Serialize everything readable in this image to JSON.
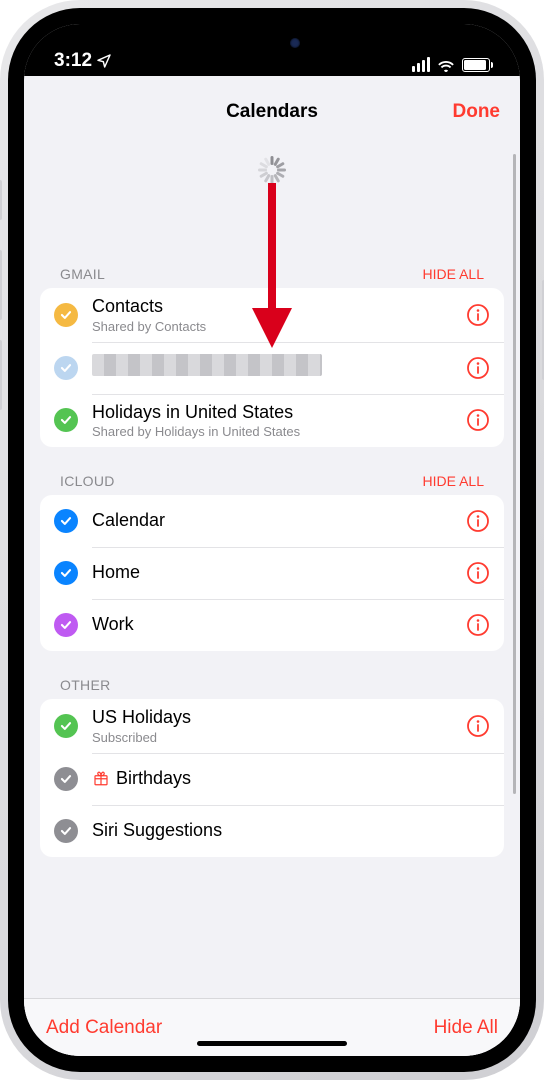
{
  "status": {
    "time": "3:12"
  },
  "header": {
    "title": "Calendars",
    "done": "Done"
  },
  "groups": [
    {
      "label": "GMAIL",
      "hide": "HIDE ALL",
      "items": [
        {
          "title": "Contacts",
          "sub": "Shared by Contacts",
          "color": "#f5b942",
          "info": true,
          "redacted": false,
          "icon": ""
        },
        {
          "title": "",
          "sub": "",
          "color": "#bcd6f0",
          "info": true,
          "redacted": true,
          "icon": ""
        },
        {
          "title": "Holidays in United States",
          "sub": "Shared by Holidays in United States",
          "color": "#54c452",
          "info": true,
          "redacted": false,
          "icon": ""
        }
      ]
    },
    {
      "label": "ICLOUD",
      "hide": "HIDE ALL",
      "items": [
        {
          "title": "Calendar",
          "sub": "",
          "color": "#0a84ff",
          "info": true,
          "redacted": false,
          "icon": ""
        },
        {
          "title": "Home",
          "sub": "",
          "color": "#0a84ff",
          "info": true,
          "redacted": false,
          "icon": ""
        },
        {
          "title": "Work",
          "sub": "",
          "color": "#bf5af2",
          "info": true,
          "redacted": false,
          "icon": ""
        }
      ]
    },
    {
      "label": "OTHER",
      "hide": "",
      "items": [
        {
          "title": "US Holidays",
          "sub": "Subscribed",
          "color": "#54c452",
          "info": true,
          "redacted": false,
          "icon": ""
        },
        {
          "title": "Birthdays",
          "sub": "",
          "color": "#8e8e93",
          "info": false,
          "redacted": false,
          "icon": "gift"
        },
        {
          "title": "Siri Suggestions",
          "sub": "",
          "color": "#8e8e93",
          "info": false,
          "redacted": false,
          "icon": ""
        }
      ]
    }
  ],
  "toolbar": {
    "add": "Add Calendar",
    "hide": "Hide All"
  }
}
